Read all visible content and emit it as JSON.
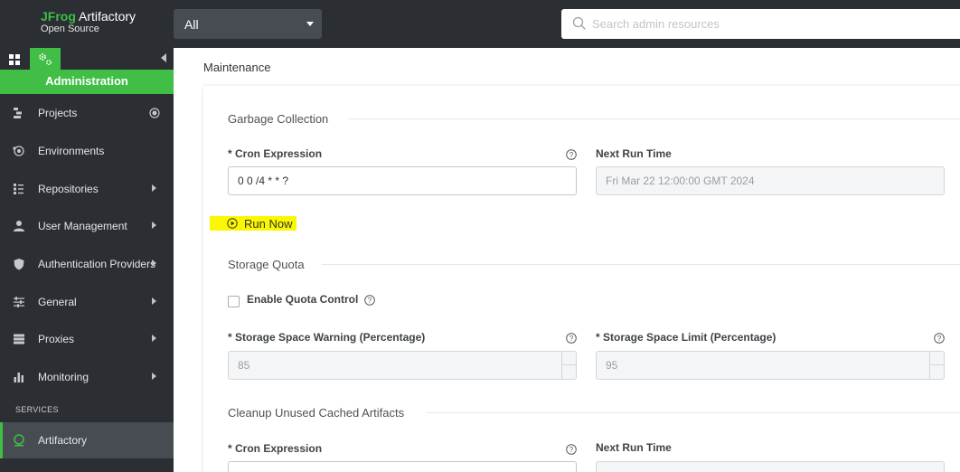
{
  "header": {
    "logo_brand_prefix": "JFrog",
    "logo_brand_suffix": " Artifactory",
    "logo_edition": "Open Source",
    "scope_select_value": "All",
    "search_placeholder": "Search admin resources"
  },
  "sidebar": {
    "section_title": "Administration",
    "items": [
      {
        "label": "Projects",
        "icon": "projects-icon"
      },
      {
        "label": "Environments",
        "icon": "environments-icon"
      },
      {
        "label": "Repositories",
        "icon": "repositories-icon"
      },
      {
        "label": "User Management",
        "icon": "user-icon"
      },
      {
        "label": "Authentication Providers",
        "icon": "shield-icon"
      },
      {
        "label": "General",
        "icon": "sliders-icon"
      },
      {
        "label": "Proxies",
        "icon": "proxies-icon"
      },
      {
        "label": "Monitoring",
        "icon": "bar-chart-icon"
      }
    ],
    "services_heading": "SERVICES",
    "active_item": {
      "label": "Artifactory",
      "icon": "artifactory-icon"
    }
  },
  "main": {
    "page_title": "Maintenance",
    "garbage_collection": {
      "title": "Garbage Collection",
      "cron_label": "* Cron Expression",
      "cron_value": "0 0 /4 * * ?",
      "next_run_label": "Next Run Time",
      "next_run_value": "Fri Mar 22 12:00:00 GMT 2024",
      "run_now_label": "Run Now"
    },
    "storage_quota": {
      "title": "Storage Quota",
      "enable_label": "Enable Quota Control",
      "warning_label": "* Storage Space Warning (Percentage)",
      "warning_value": "85",
      "limit_label": "* Storage Space Limit (Percentage)",
      "limit_value": "95"
    },
    "cleanup": {
      "title": "Cleanup Unused Cached Artifacts",
      "cron_label": "* Cron Expression",
      "next_run_label": "Next Run Time"
    }
  },
  "colors": {
    "accent_green": "#40be46",
    "sidebar_bg": "#2b2e33",
    "highlight_yellow": "#faf700"
  }
}
